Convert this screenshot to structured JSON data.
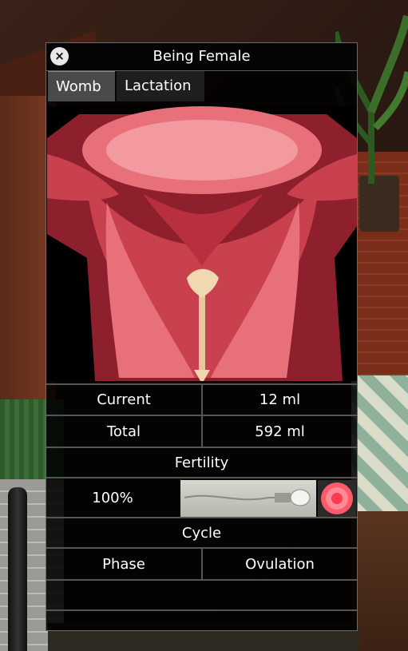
{
  "window": {
    "title": "Being Female",
    "close_icon": "×"
  },
  "tabs": [
    {
      "label": "Womb",
      "active": true
    },
    {
      "label": "Lactation",
      "active": false
    }
  ],
  "stats": {
    "current_label": "Current",
    "current_value": "12 ml",
    "total_label": "Total",
    "total_value": "592 ml"
  },
  "fertility": {
    "heading": "Fertility",
    "percent": "100%"
  },
  "cycle": {
    "heading": "Cycle",
    "phase_label": "Phase",
    "phase_value": "Ovulation"
  },
  "colors": {
    "womb_outer": "#8e1f2c",
    "womb_mid": "#c9404f",
    "womb_light": "#e8707a",
    "womb_highlight": "#f29aa0",
    "cervix_fluid": "#f0d8b0",
    "ovum": "#ff5a6a"
  }
}
